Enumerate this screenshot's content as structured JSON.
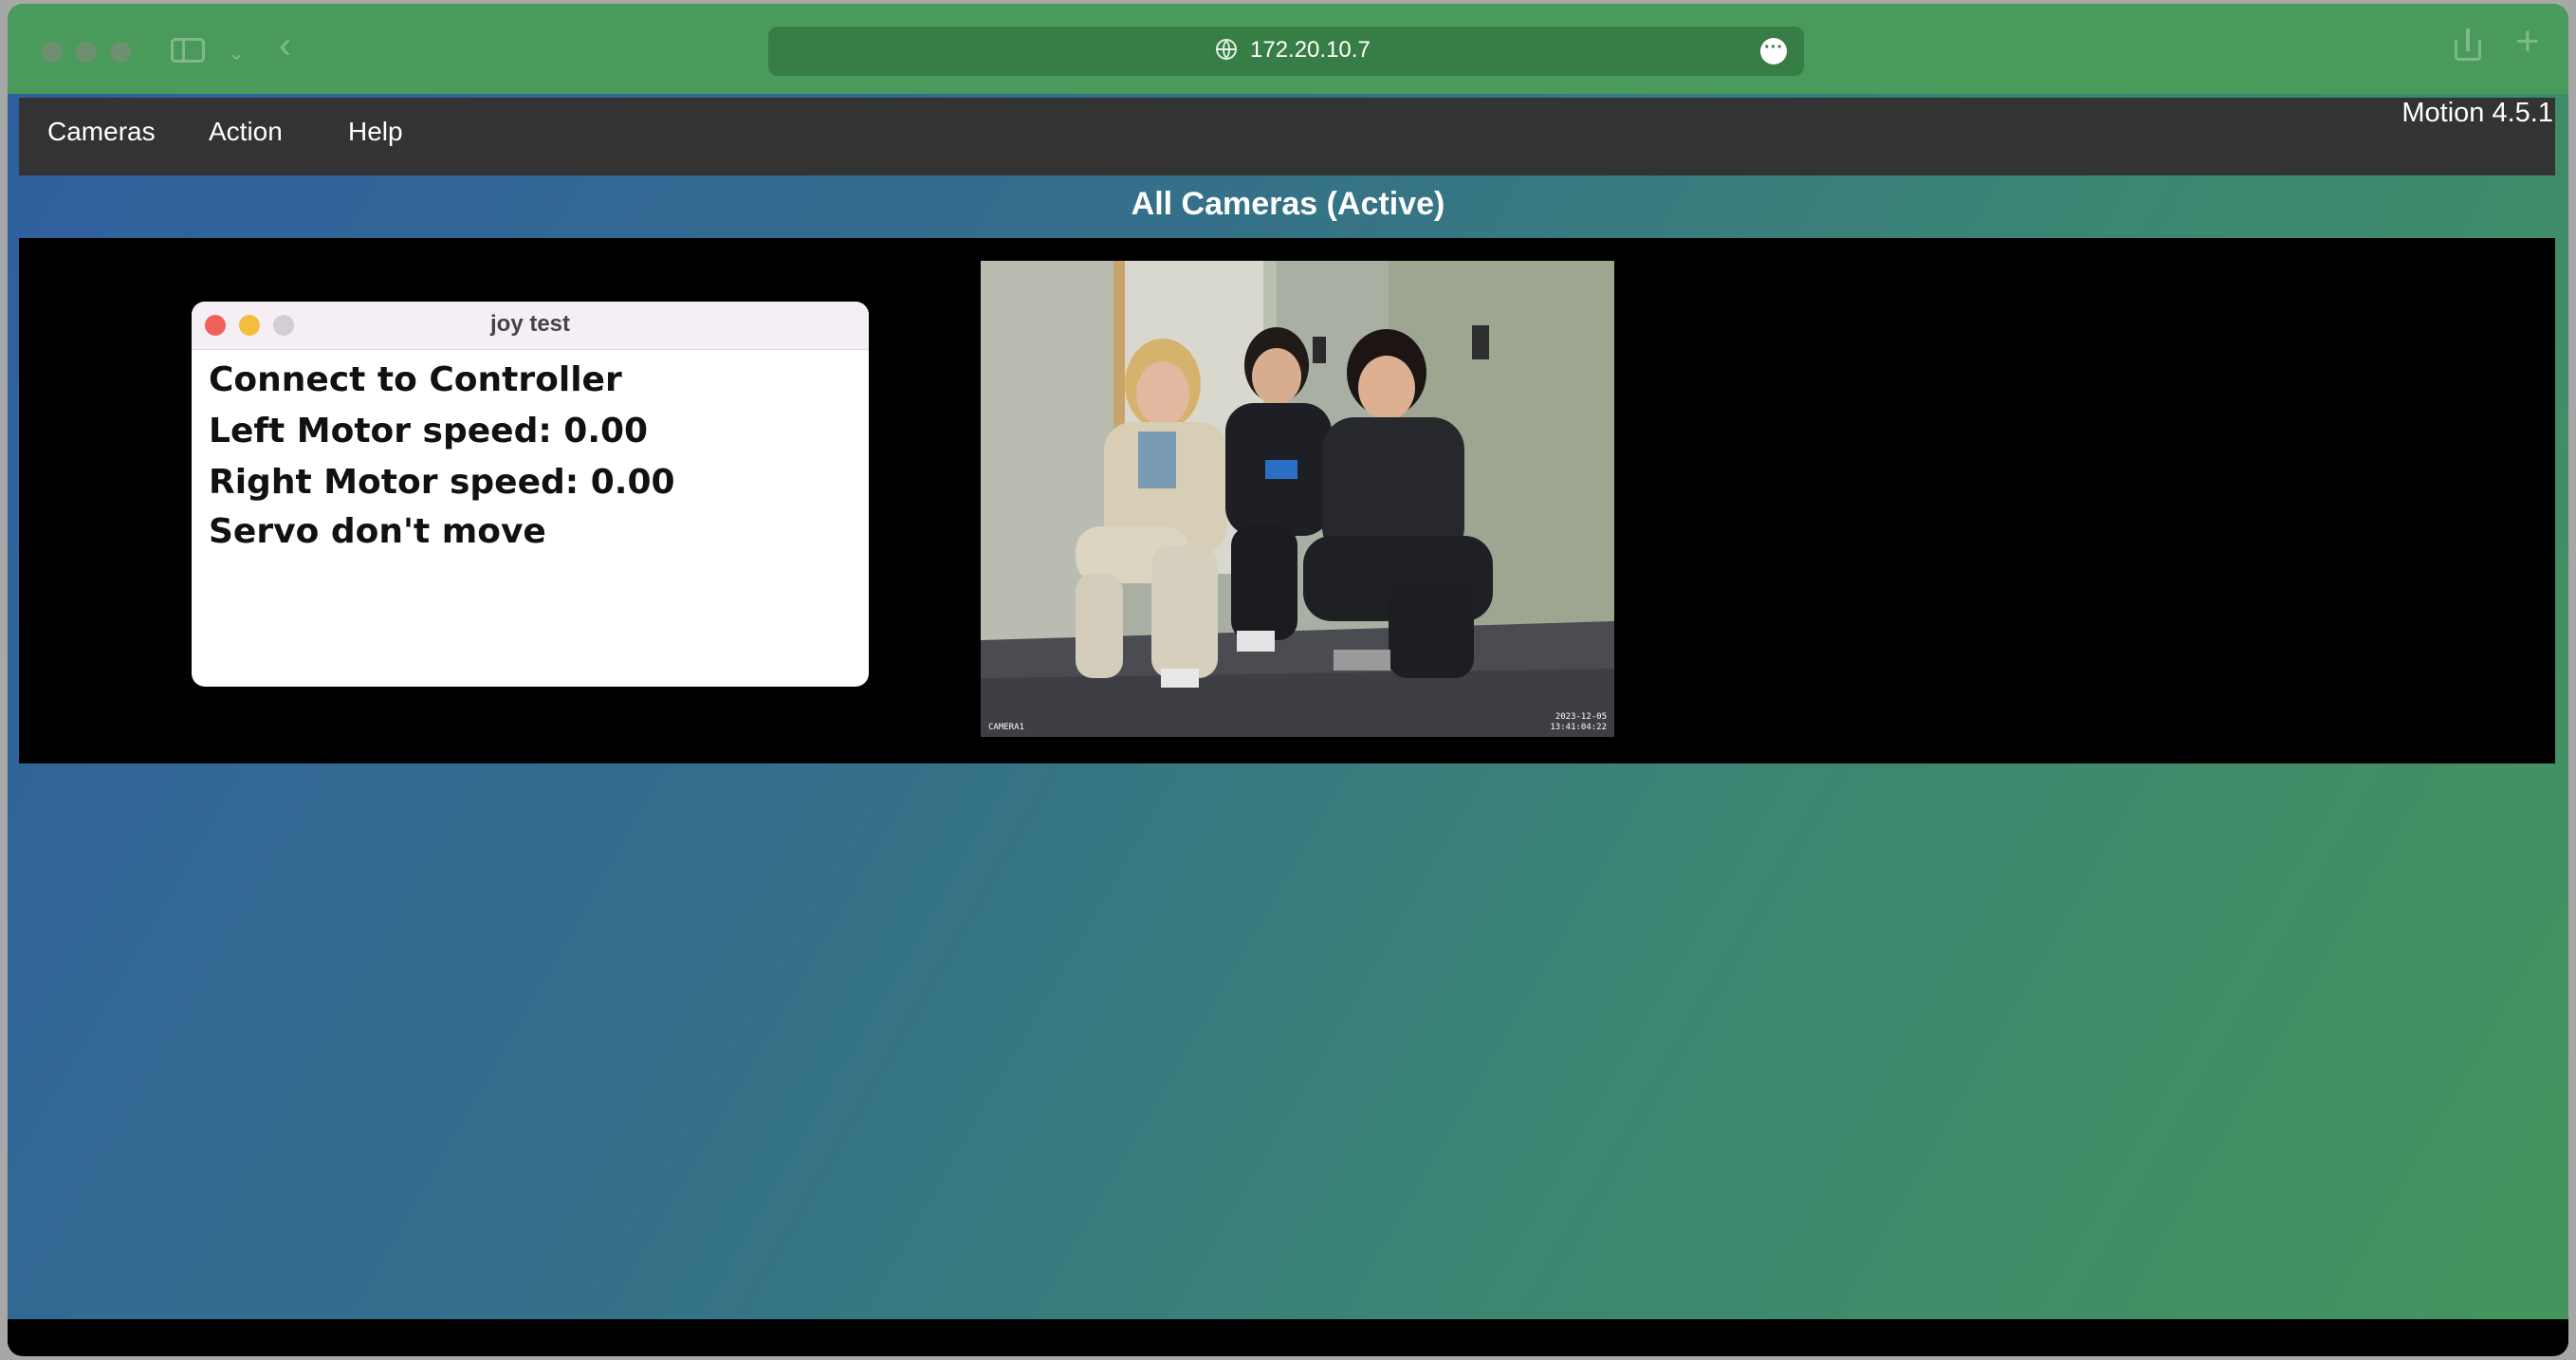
{
  "browser": {
    "url": "172.20.10.7"
  },
  "nav": {
    "items": [
      "Cameras",
      "Action",
      "Help"
    ],
    "version": "Motion 4.5.1"
  },
  "page": {
    "title": "All Cameras (Active)"
  },
  "joy_window": {
    "title": "joy test",
    "lines": [
      "Connect to Controller",
      "Left Motor speed: 0.00",
      "Right Motor speed: 0.00",
      "Servo don't move"
    ]
  },
  "camera_feed": {
    "label": "CAMERA1",
    "timestamp_date": "2023-12-05",
    "timestamp_time": "13:41:04:22"
  },
  "icons": {
    "globe": "globe-icon",
    "more": "ellipsis-icon",
    "share": "share-icon",
    "new_tab": "plus-icon",
    "sidebar": "sidebar-icon",
    "back": "chevron-left-icon"
  },
  "colors": {
    "chrome": "#4a9a5c",
    "urlbar": "#367e46",
    "navbar": "#333333",
    "panel": "#000000",
    "close": "#f0605a",
    "minimize": "#f5bd3f"
  }
}
